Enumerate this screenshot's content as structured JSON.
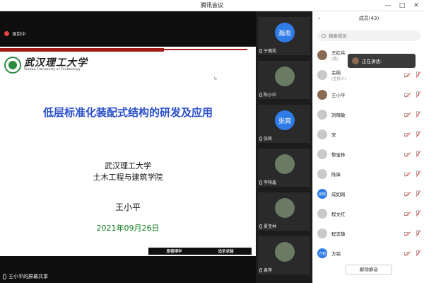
{
  "window": {
    "title": "腾讯会议"
  },
  "recording": {
    "label": "录制中"
  },
  "slide": {
    "logo_cn": "武汉理工大学",
    "logo_en": "Wuhan University of Technology",
    "title": "低层标准化装配式结构的研发及应用",
    "school": "武汉理工大学",
    "college": "土木工程与建筑学院",
    "presenter": "王小平",
    "date": "2021年09月26日",
    "footer_left": "厚德博学",
    "footer_right": "追求卓越"
  },
  "share": {
    "label": "王小平的屏幕共享"
  },
  "videos": [
    {
      "avatar_text": "瀚淞",
      "name": "于瀚淞",
      "type": "blue"
    },
    {
      "avatar_text": "",
      "name": "陈小中",
      "type": "photo"
    },
    {
      "avatar_text": "张爽",
      "name": "张爽",
      "type": "blue"
    },
    {
      "avatar_text": "",
      "name": "李杨鑫",
      "type": "photo"
    },
    {
      "avatar_text": "",
      "name": "夏宝林",
      "type": "photo"
    },
    {
      "avatar_text": "",
      "name": "袁萍",
      "type": "photo"
    }
  ],
  "panel": {
    "title": "成员(43)",
    "search_placeholder": "搜索成员",
    "members": [
      {
        "name": "王红兵",
        "role": "(我)",
        "avatar": "person"
      },
      {
        "name": "余绢",
        "role": "(主持人)",
        "avatar": "grey"
      },
      {
        "name": "王小平",
        "role": "",
        "avatar": "person"
      },
      {
        "name": "刘晓敏",
        "role": "",
        "avatar": "grey"
      },
      {
        "name": "宋",
        "role": "",
        "avatar": "grey"
      },
      {
        "name": "黎宝林",
        "role": "",
        "avatar": "grey"
      },
      {
        "name": "陈锋",
        "role": "",
        "avatar": "grey"
      },
      {
        "name": "成如刚",
        "role": "",
        "avatar": "blue",
        "avatar_text": "如刚"
      },
      {
        "name": "程文红",
        "role": "",
        "avatar": "grey"
      },
      {
        "name": "程志雄",
        "role": "",
        "avatar": "grey"
      },
      {
        "name": "方韬",
        "role": "",
        "avatar": "blue",
        "avatar_text": "方韬"
      }
    ],
    "speaking_label": "正在讲话:",
    "mute_all_label": "解除静音"
  }
}
